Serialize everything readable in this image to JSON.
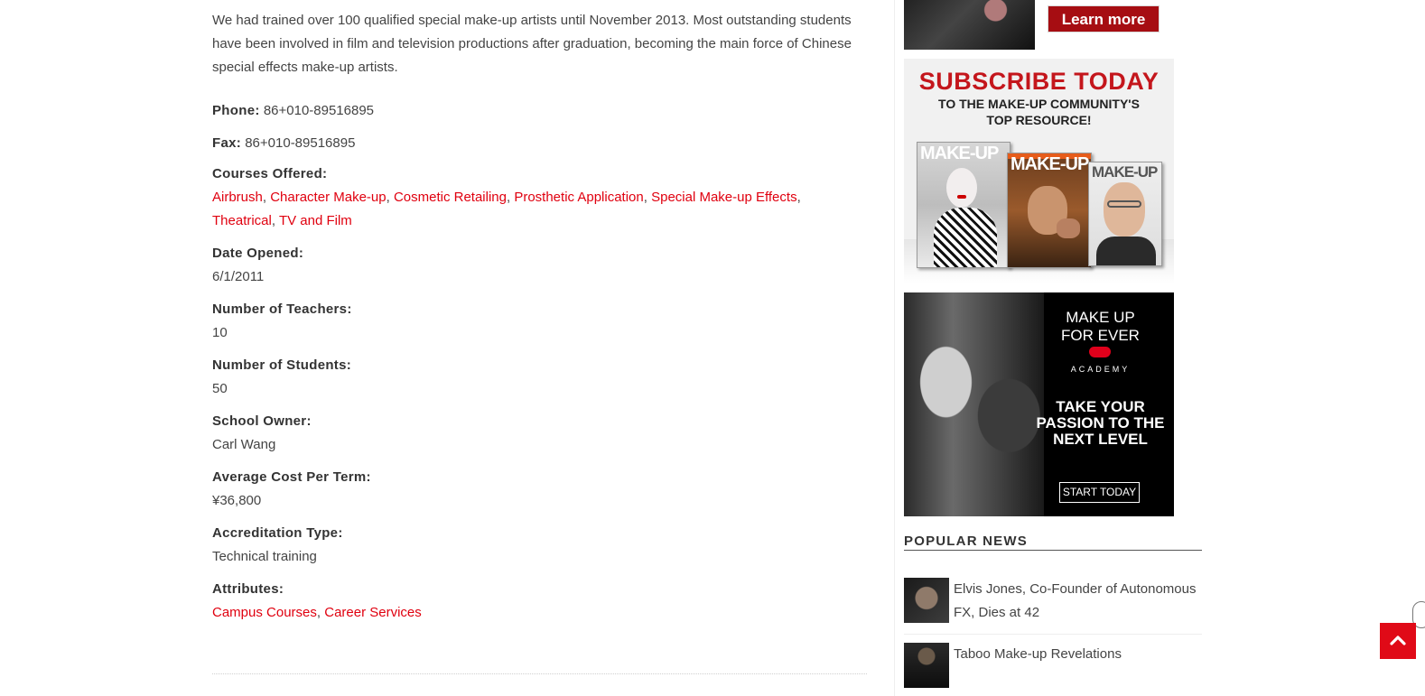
{
  "school": {
    "intro": "We had trained over 100 qualified special make-up artists until November 2013. Most outstanding students have been involved in film and television productions after graduation, becoming the main force of Chinese special effects make-up artists.",
    "phone": {
      "label": "Phone:",
      "value": "86+010-89516895"
    },
    "fax": {
      "label": "Fax:",
      "value": "86+010-89516895"
    },
    "courses": {
      "label": "Courses Offered:",
      "items": [
        "Airbrush",
        "Character Make-up",
        "Cosmetic Retailing",
        "Prosthetic Application",
        "Special Make-up Effects",
        "Theatrical",
        "TV and Film"
      ],
      "separator": ", "
    },
    "date_opened": {
      "label": "Date Opened:",
      "value": "6/1/2011"
    },
    "teachers": {
      "label": "Number of Teachers:",
      "value": "10"
    },
    "students": {
      "label": "Number of Students:",
      "value": "50"
    },
    "owner": {
      "label": "School Owner:",
      "value": "Carl Wang"
    },
    "cost": {
      "label": "Average Cost Per Term:",
      "value": "¥36,800"
    },
    "accreditation": {
      "label": "Accreditation Type:",
      "value": "Technical training"
    },
    "attributes": {
      "label": "Attributes:",
      "items": [
        "Campus Courses",
        "Career Services"
      ],
      "separator": ", "
    }
  },
  "sidebar": {
    "ad_top": {
      "button_label": "Learn more"
    },
    "ad_subscribe": {
      "headline": "SUBSCRIBE TODAY",
      "subline_1": "TO THE MAKE-UP COMMUNITY'S",
      "subline_2": "TOP RESOURCE!",
      "magazine_title": "MAKE-UP"
    },
    "ad_academy": {
      "brand_1": "MAKE UP",
      "brand_2": "FOR EVER",
      "academy": "ACADEMY",
      "tagline_1": "TAKE YOUR",
      "tagline_2": "PASSION TO THE",
      "tagline_3": "NEXT LEVEL",
      "cta": "START TODAY"
    },
    "popular_news": {
      "title": "POPULAR NEWS",
      "items": [
        {
          "title": "Elvis Jones, Co-Founder of Autonomous FX, Dies at 42"
        },
        {
          "title": "Taboo Make-up Revelations"
        }
      ]
    }
  },
  "colors": {
    "link": "#e0000f",
    "accent": "#e00a17",
    "text": "#444444"
  },
  "icons": {
    "back_to_top": "chevron-up-icon"
  }
}
